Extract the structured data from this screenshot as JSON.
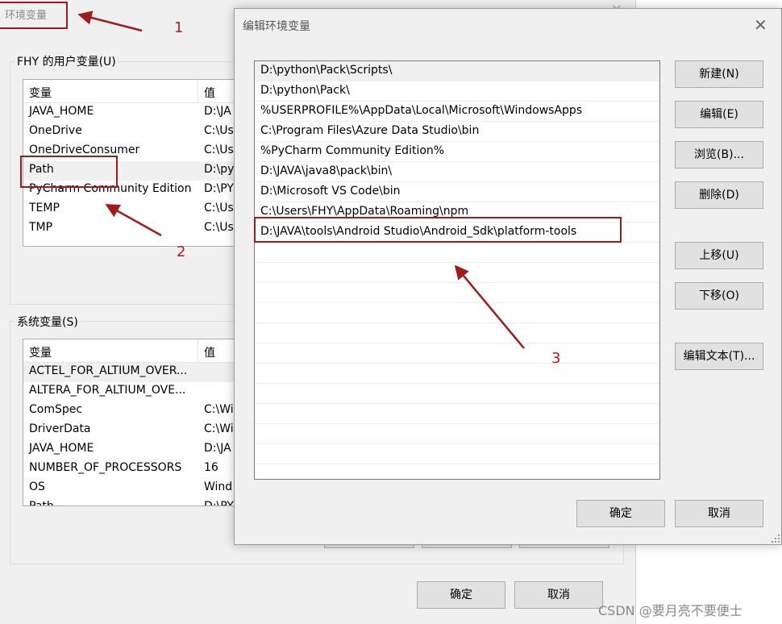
{
  "env_window": {
    "title": "环境变量",
    "close_glyph": "✕",
    "user_group_label": "FHY 的用户变量(U)",
    "user_vars": {
      "col_var": "变量",
      "col_val": "值",
      "rows": [
        {
          "name": "JAVA_HOME",
          "value": "D:\\JA"
        },
        {
          "name": "OneDrive",
          "value": "C:\\Us"
        },
        {
          "name": "OneDriveConsumer",
          "value": "C:\\Us"
        },
        {
          "name": "Path",
          "value": "D:\\py"
        },
        {
          "name": "PyCharm Community Edition",
          "value": "D:\\PY"
        },
        {
          "name": "TEMP",
          "value": "C:\\Us"
        },
        {
          "name": "TMP",
          "value": "C:\\Us"
        }
      ]
    },
    "system_group_label": "系统变量(S)",
    "system_vars": {
      "col_var": "变量",
      "col_val": "值",
      "rows": [
        {
          "name": "ACTEL_FOR_ALTIUM_OVER...",
          "value": ""
        },
        {
          "name": "ALTERA_FOR_ALTIUM_OVE...",
          "value": ""
        },
        {
          "name": "ComSpec",
          "value": "C:\\Wi"
        },
        {
          "name": "DriverData",
          "value": "C:\\Wi"
        },
        {
          "name": "JAVA_HOME",
          "value": "D:\\JA"
        },
        {
          "name": "NUMBER_OF_PROCESSORS",
          "value": "16"
        },
        {
          "name": "OS",
          "value": "Wind"
        },
        {
          "name": "Path",
          "value": "D:\\PY"
        }
      ]
    },
    "ok_label": "确定",
    "cancel_label": "取消"
  },
  "edit_window": {
    "title": "编辑环境变量",
    "close_glyph": "✕",
    "paths": [
      "D:\\python\\Pack\\Scripts\\",
      "D:\\python\\Pack\\",
      "%USERPROFILE%\\AppData\\Local\\Microsoft\\WindowsApps",
      "C:\\Program Files\\Azure Data Studio\\bin",
      "%PyCharm Community Edition%",
      "D:\\JAVA\\java8\\pack\\bin\\",
      "D:\\Microsoft VS Code\\bin",
      "C:\\Users\\FHY\\AppData\\Roaming\\npm",
      "D:\\JAVA\\tools\\Android Studio\\Android_Sdk\\platform-tools"
    ],
    "buttons": {
      "new": "新建(N)",
      "edit": "编辑(E)",
      "browse": "浏览(B)...",
      "delete": "删除(D)",
      "move_up": "上移(U)",
      "move_down": "下移(O)",
      "edit_text": "编辑文本(T)...",
      "ok": "确定",
      "cancel": "取消"
    }
  },
  "annotations": {
    "color": "#a01c1c",
    "labels": [
      "1",
      "2",
      "3"
    ]
  },
  "watermark": "CSDN @要月亮不要便士"
}
